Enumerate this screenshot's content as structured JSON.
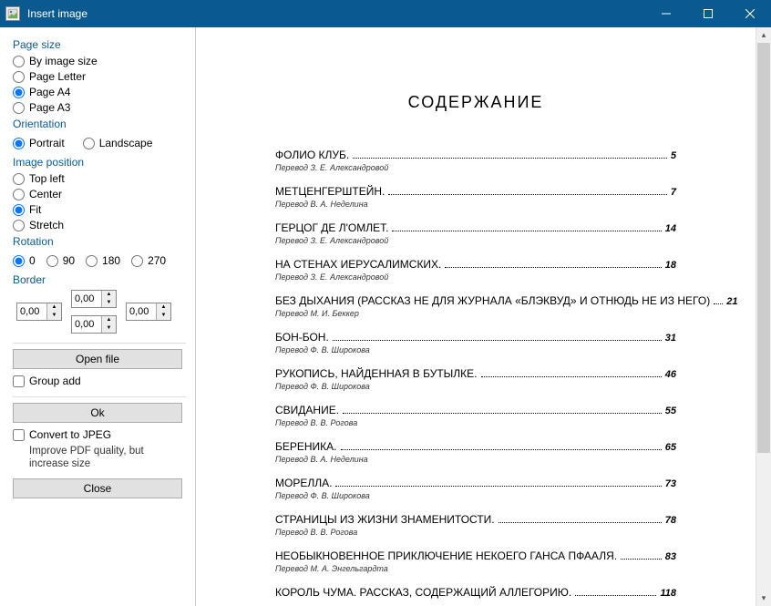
{
  "window": {
    "title": "Insert image"
  },
  "sidebar": {
    "page_size": {
      "label": "Page size",
      "options": [
        "By image size",
        "Page Letter",
        "Page A4",
        "Page A3"
      ],
      "selected": 2
    },
    "orientation": {
      "label": "Orientation",
      "options": [
        "Portrait",
        "Landscape"
      ],
      "selected": 0
    },
    "position": {
      "label": "Image position",
      "options": [
        "Top left",
        "Center",
        "Fit",
        "Stretch"
      ],
      "selected": 2
    },
    "rotation": {
      "label": "Rotation",
      "options": [
        "0",
        "90",
        "180",
        "270"
      ],
      "selected": 0
    },
    "border": {
      "label": "Border",
      "left": "0,00",
      "top": "0,00",
      "right": "0,00",
      "bottom": "0,00"
    },
    "open_file": "Open file",
    "group_add": "Group add",
    "ok": "Ok",
    "convert_jpeg": "Convert to JPEG",
    "convert_sub": "Improve PDF quality, but increase size",
    "close": "Close"
  },
  "document": {
    "title": "СОДЕРЖАНИЕ",
    "entries": [
      {
        "name": "ФОЛИО КЛУБ.",
        "sub": "Перевод З. Е. Александровой",
        "page": "5"
      },
      {
        "name": "МЕТЦЕНГЕРШТЕЙН.",
        "sub": "Перевод В. А. Неделина",
        "page": "7"
      },
      {
        "name": "ГЕРЦОГ ДЕ Л'ОМЛЕТ.",
        "sub": "Перевод З. Е. Александровой",
        "page": "14"
      },
      {
        "name": "НА СТЕНАХ ИЕРУСАЛИМСКИХ.",
        "sub": "Перевод З. Е. Александровой",
        "page": "18"
      },
      {
        "name": "БЕЗ ДЫХАНИЯ (Рассказ не для журнала «Блэквуд» и отнюдь не из него)",
        "sub": "Перевод М. И. Беккер",
        "page": "21"
      },
      {
        "name": "БОН-БОН.",
        "sub": "Перевод Ф. В. Широкова",
        "page": "31"
      },
      {
        "name": "РУКОПИСЬ, НАЙДЕННАЯ В БУТЫЛКЕ.",
        "sub": "Перевод Ф. В. Широкова",
        "page": "46"
      },
      {
        "name": "СВИДАНИЕ.",
        "sub": "Перевод В. В. Рогова",
        "page": "55"
      },
      {
        "name": "БЕРЕНИКА.",
        "sub": "Перевод В. А. Неделина",
        "page": "65"
      },
      {
        "name": "МОРЕЛЛА.",
        "sub": "Перевод Ф. В. Широкова",
        "page": "73"
      },
      {
        "name": "СТРАНИЦЫ ИЗ ЖИЗНИ ЗНАМЕНИТОСТИ.",
        "sub": "Перевод В. В. Рогова",
        "page": "78"
      },
      {
        "name": "НЕОБЫКНОВЕННОЕ ПРИКЛЮЧЕНИЕ НЕКОЕГО ГАНСА ПФААЛЯ.",
        "sub": "Перевод М. А. Энгельгардта",
        "page": "83"
      },
      {
        "name": "КОРОЛЬ ЧУМА. Рассказ, содержащий аллегорию.",
        "sub": "",
        "page": "118"
      }
    ]
  }
}
